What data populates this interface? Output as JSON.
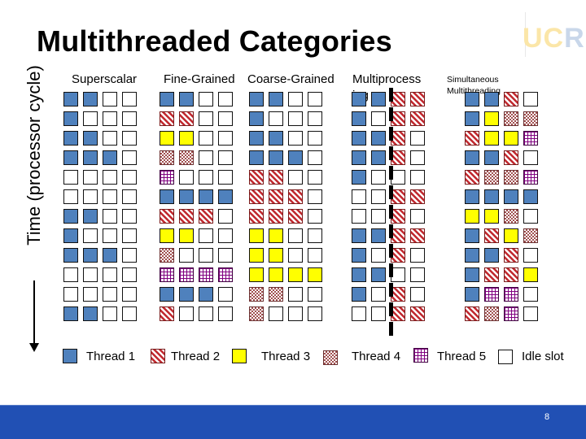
{
  "title": "Multithreaded Categories",
  "axis_label": "Time (processor cycle)",
  "logo": {
    "text_a": "UC",
    "text_b": "R"
  },
  "columns": [
    {
      "label": "Superscalar",
      "rows": [
        "1100",
        "1000",
        "1100",
        "1110",
        "0000",
        "0000",
        "1100",
        "1000",
        "1110",
        "0000",
        "0000",
        "1100"
      ]
    },
    {
      "label": "Fine-Grained",
      "rows": [
        "1100",
        "2200",
        "3300",
        "4400",
        "5000",
        "1111",
        "2220",
        "3300",
        "4000",
        "5555",
        "1110",
        "2000"
      ]
    },
    {
      "label": "Coarse-Grained",
      "rows": [
        "1100",
        "1000",
        "1100",
        "1110",
        "2200",
        "2220",
        "2220",
        "3300",
        "3300",
        "3333",
        "4400",
        "4000"
      ]
    },
    {
      "label": "Multiprocess",
      "label_wrap": "ing",
      "rows": [
        "1122",
        "1022",
        "1120",
        "1120",
        "1000",
        "0022",
        "0020",
        "1122",
        "1020",
        "1100",
        "1020",
        "0022"
      ]
    },
    {
      "label": "Simultaneous",
      "label_wrap": "Multithreading",
      "rows": [
        "1120",
        "1344",
        "2335",
        "1120",
        "2445",
        "1111",
        "3340",
        "1234",
        "1120",
        "1223",
        "1550",
        "2450"
      ]
    }
  ],
  "legend": [
    {
      "code": 1,
      "label": "Thread 1",
      "color": "#4f81bd",
      "pattern": "solid"
    },
    {
      "code": 2,
      "label": "Thread 2",
      "color": "#c0272d",
      "pattern": "diagonal-stripes"
    },
    {
      "code": 3,
      "label": "Thread 3",
      "color": "#ffff00",
      "pattern": "solid"
    },
    {
      "code": 4,
      "label": "Thread 4",
      "color": "#a05050",
      "pattern": "checker"
    },
    {
      "code": 5,
      "label": "Thread 5",
      "color": "#800080",
      "pattern": "grid"
    },
    {
      "code": 0,
      "label": "Idle slot",
      "color": "#ffffff",
      "pattern": "empty"
    }
  ],
  "footer": {
    "page_number": "8",
    "color": "#2150b4"
  }
}
